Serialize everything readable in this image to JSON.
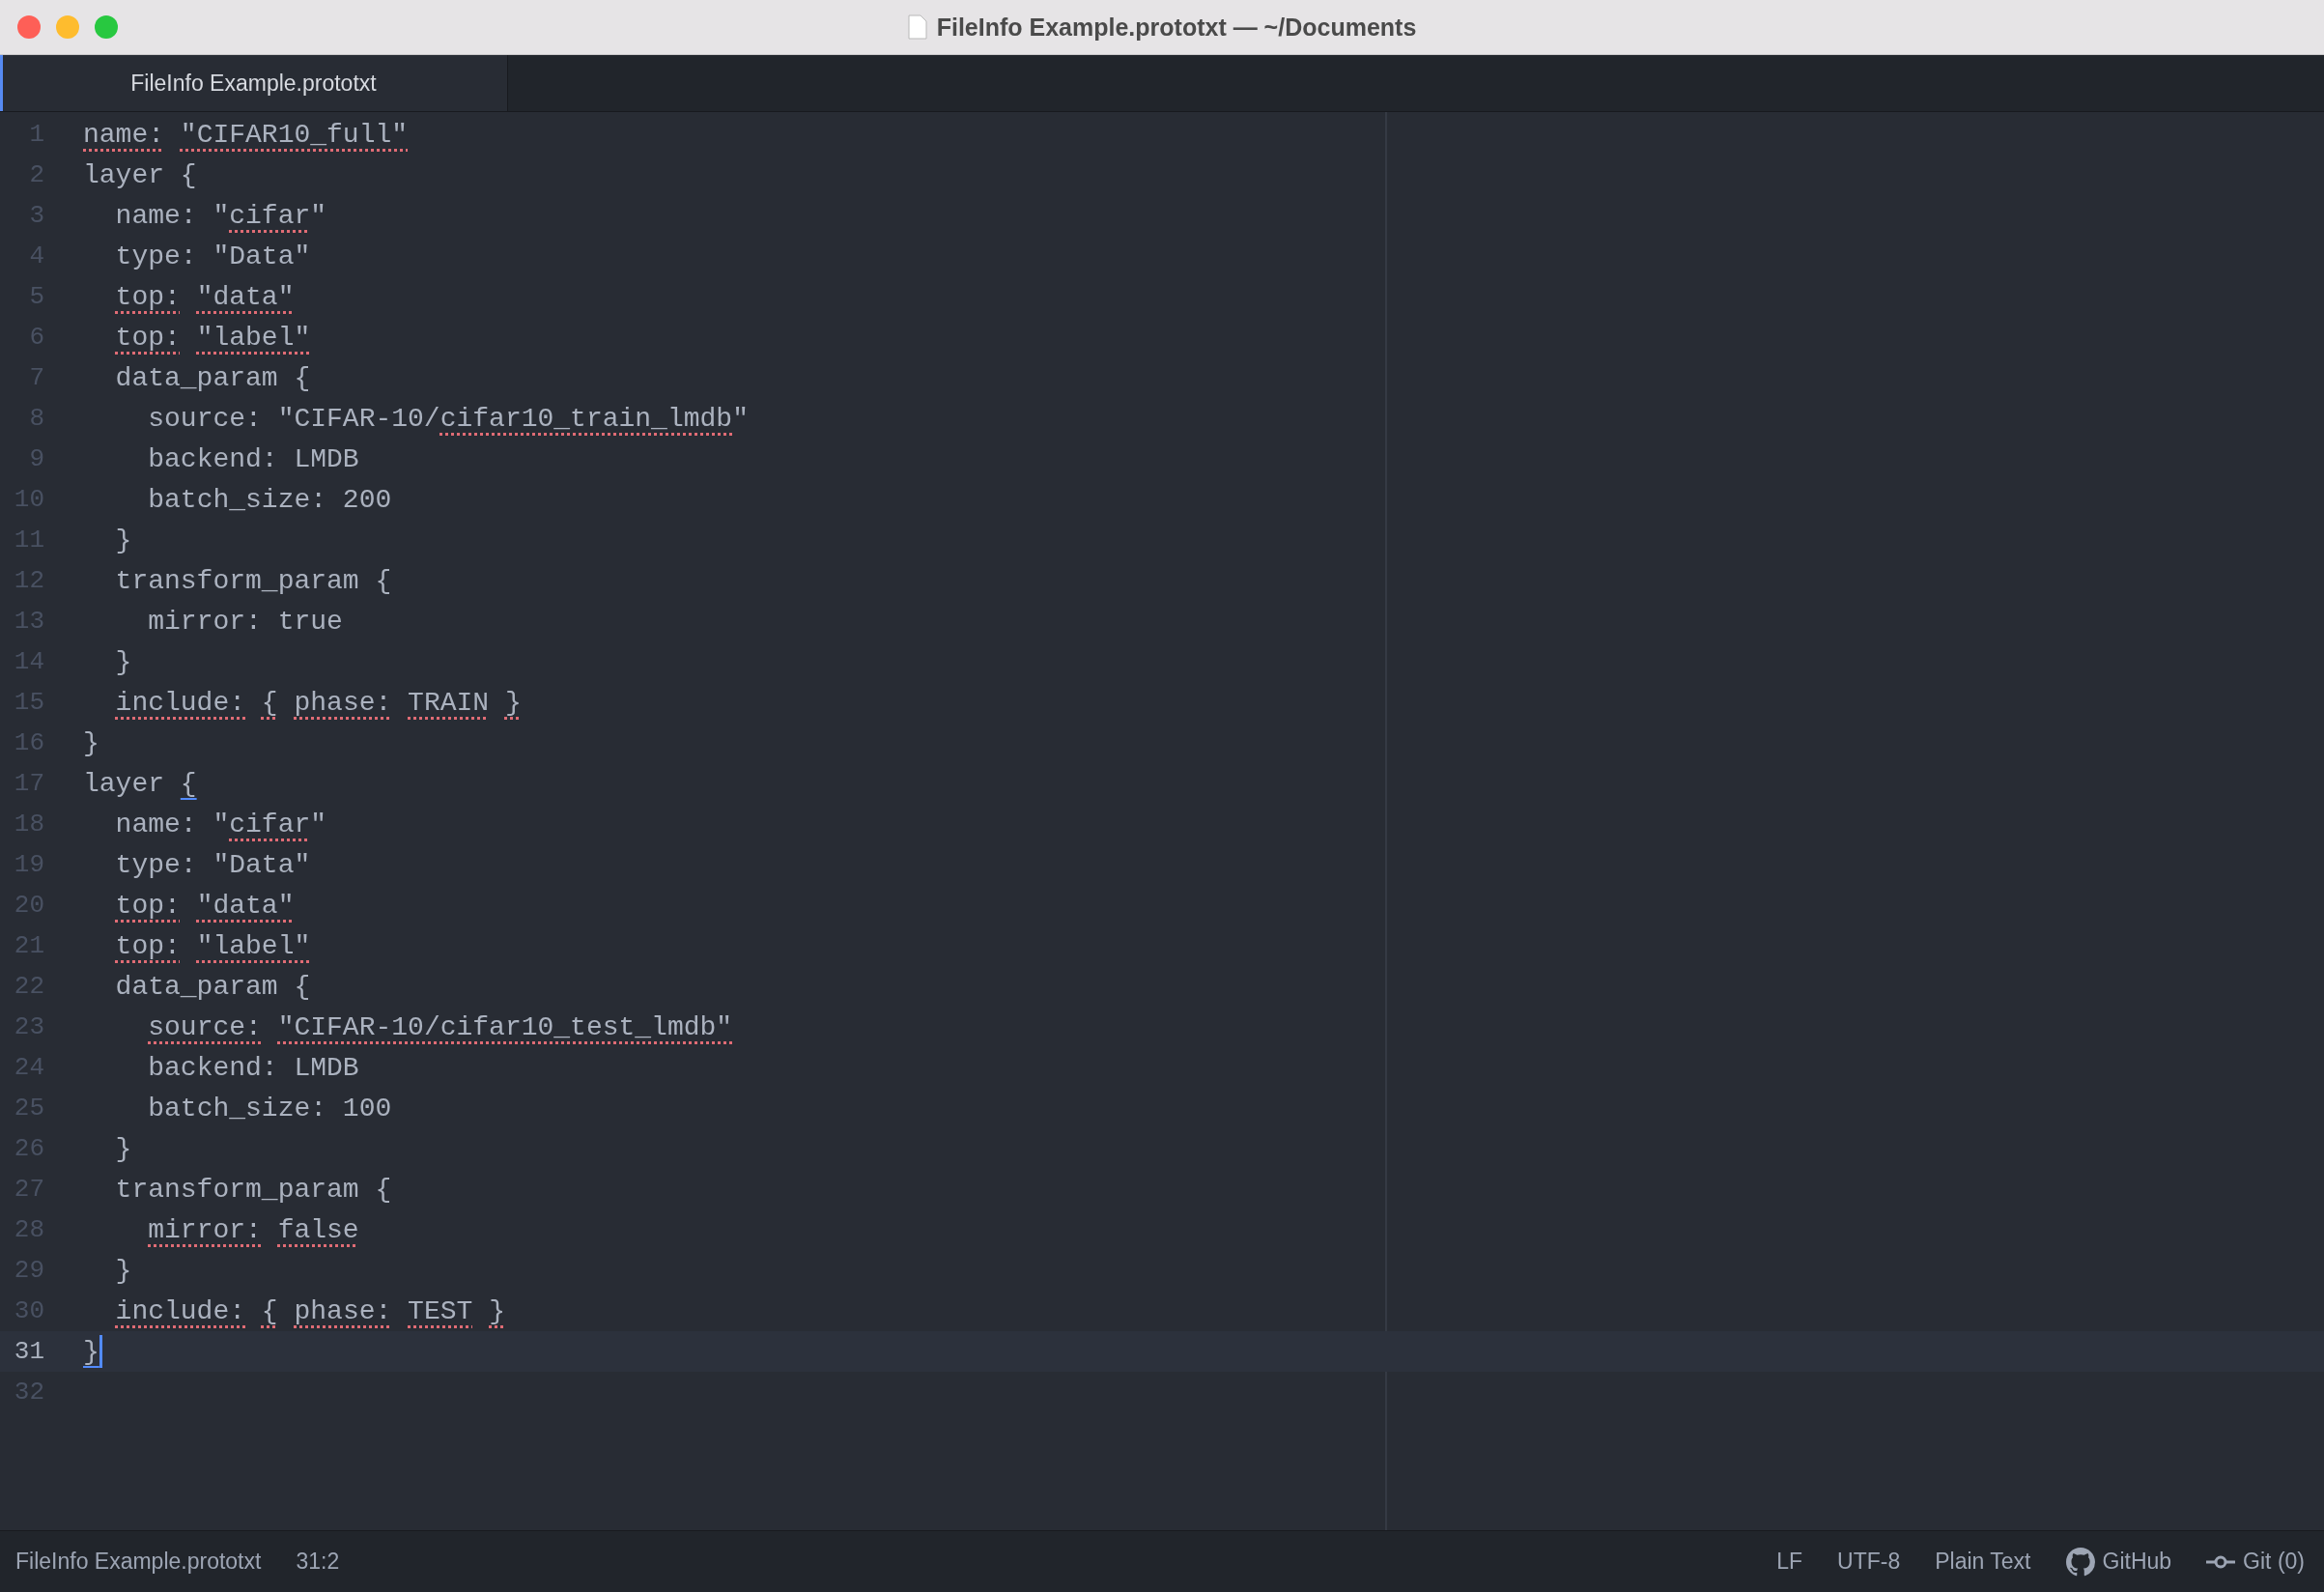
{
  "window": {
    "title": "FileInfo Example.prototxt — ~/Documents"
  },
  "tabs": [
    {
      "label": "FileInfo Example.prototxt",
      "selected": true
    }
  ],
  "editor": {
    "lines": [
      {
        "number": "1",
        "current": false,
        "segments": [
          {
            "text": "name:",
            "kind": "misspelled"
          },
          {
            "text": " \"CIFAR10_full\"",
            "kind": "misspelled"
          }
        ]
      },
      {
        "number": "2",
        "current": false,
        "segments": [
          {
            "text": "layer {",
            "kind": "plain"
          }
        ]
      },
      {
        "number": "3",
        "current": false,
        "segments": [
          {
            "text": "  name: \"",
            "kind": "plain"
          },
          {
            "text": "cifar",
            "kind": "misspelled"
          },
          {
            "text": "\"",
            "kind": "plain"
          }
        ]
      },
      {
        "number": "4",
        "current": false,
        "segments": [
          {
            "text": "  type: \"Data\"",
            "kind": "plain"
          }
        ]
      },
      {
        "number": "5",
        "current": false,
        "segments": [
          {
            "text": "  top:",
            "kind": "misspelled"
          },
          {
            "text": " \"data\"",
            "kind": "misspelled"
          }
        ]
      },
      {
        "number": "6",
        "current": false,
        "segments": [
          {
            "text": "  top:",
            "kind": "misspelled"
          },
          {
            "text": " \"label\"",
            "kind": "misspelled"
          }
        ]
      },
      {
        "number": "7",
        "current": false,
        "segments": [
          {
            "text": "  data_param {",
            "kind": "plain"
          }
        ]
      },
      {
        "number": "8",
        "current": false,
        "segments": [
          {
            "text": "    source: \"CIFAR-10/",
            "kind": "plain"
          },
          {
            "text": "cifar10_train_lmdb",
            "kind": "misspelled"
          },
          {
            "text": "\"",
            "kind": "plain"
          }
        ]
      },
      {
        "number": "9",
        "current": false,
        "segments": [
          {
            "text": "    backend: LMDB",
            "kind": "plain"
          }
        ]
      },
      {
        "number": "10",
        "current": false,
        "segments": [
          {
            "text": "    batch_size: 200",
            "kind": "plain"
          }
        ]
      },
      {
        "number": "11",
        "current": false,
        "segments": [
          {
            "text": "  }",
            "kind": "plain"
          }
        ]
      },
      {
        "number": "12",
        "current": false,
        "segments": [
          {
            "text": "  transform_param {",
            "kind": "plain"
          }
        ]
      },
      {
        "number": "13",
        "current": false,
        "segments": [
          {
            "text": "    mirror: true",
            "kind": "plain"
          }
        ]
      },
      {
        "number": "14",
        "current": false,
        "segments": [
          {
            "text": "  }",
            "kind": "plain"
          }
        ]
      },
      {
        "number": "15",
        "current": false,
        "segments": [
          {
            "text": "  include:",
            "kind": "misspelled"
          },
          {
            "text": " {",
            "kind": "misspelled"
          },
          {
            "text": " phase:",
            "kind": "misspelled"
          },
          {
            "text": " TRAIN",
            "kind": "misspelled"
          },
          {
            "text": " }",
            "kind": "misspelled"
          }
        ]
      },
      {
        "number": "16",
        "current": false,
        "segments": [
          {
            "text": "}",
            "kind": "plain"
          }
        ]
      },
      {
        "number": "17",
        "current": false,
        "segments": [
          {
            "text": "layer ",
            "kind": "plain"
          },
          {
            "text": "{",
            "kind": "bracket-match"
          }
        ]
      },
      {
        "number": "18",
        "current": false,
        "segments": [
          {
            "text": "  name: \"",
            "kind": "plain"
          },
          {
            "text": "cifar",
            "kind": "misspelled"
          },
          {
            "text": "\"",
            "kind": "plain"
          }
        ]
      },
      {
        "number": "19",
        "current": false,
        "segments": [
          {
            "text": "  type: \"Data\"",
            "kind": "plain"
          }
        ]
      },
      {
        "number": "20",
        "current": false,
        "segments": [
          {
            "text": "  top:",
            "kind": "misspelled"
          },
          {
            "text": " \"data\"",
            "kind": "misspelled"
          }
        ]
      },
      {
        "number": "21",
        "current": false,
        "segments": [
          {
            "text": "  top:",
            "kind": "misspelled"
          },
          {
            "text": " \"label\"",
            "kind": "misspelled"
          }
        ]
      },
      {
        "number": "22",
        "current": false,
        "segments": [
          {
            "text": "  data_param {",
            "kind": "plain"
          }
        ]
      },
      {
        "number": "23",
        "current": false,
        "segments": [
          {
            "text": "    source:",
            "kind": "misspelled"
          },
          {
            "text": " \"CIFAR-10/cifar10_test_lmdb\"",
            "kind": "misspelled"
          }
        ]
      },
      {
        "number": "24",
        "current": false,
        "segments": [
          {
            "text": "    backend: LMDB",
            "kind": "plain"
          }
        ]
      },
      {
        "number": "25",
        "current": false,
        "segments": [
          {
            "text": "    batch_size: 100",
            "kind": "plain"
          }
        ]
      },
      {
        "number": "26",
        "current": false,
        "segments": [
          {
            "text": "  }",
            "kind": "plain"
          }
        ]
      },
      {
        "number": "27",
        "current": false,
        "segments": [
          {
            "text": "  transform_param {",
            "kind": "plain"
          }
        ]
      },
      {
        "number": "28",
        "current": false,
        "segments": [
          {
            "text": "    mirror:",
            "kind": "misspelled"
          },
          {
            "text": " false",
            "kind": "misspelled"
          }
        ]
      },
      {
        "number": "29",
        "current": false,
        "segments": [
          {
            "text": "  }",
            "kind": "plain"
          }
        ]
      },
      {
        "number": "30",
        "current": false,
        "segments": [
          {
            "text": "  include:",
            "kind": "misspelled"
          },
          {
            "text": " {",
            "kind": "misspelled"
          },
          {
            "text": " phase:",
            "kind": "misspelled"
          },
          {
            "text": " TEST",
            "kind": "misspelled"
          },
          {
            "text": " }",
            "kind": "misspelled"
          }
        ]
      },
      {
        "number": "31",
        "current": true,
        "segments": [
          {
            "text": "}",
            "kind": "bracket-match"
          }
        ]
      },
      {
        "number": "32",
        "current": false
      }
    ]
  },
  "status_bar": {
    "file": "FileInfo Example.prototxt",
    "cursor_position": "31:2",
    "line_ending": "LF",
    "encoding": "UTF-8",
    "grammar": "Plain Text",
    "github": "GitHub",
    "git": "Git (0)"
  }
}
